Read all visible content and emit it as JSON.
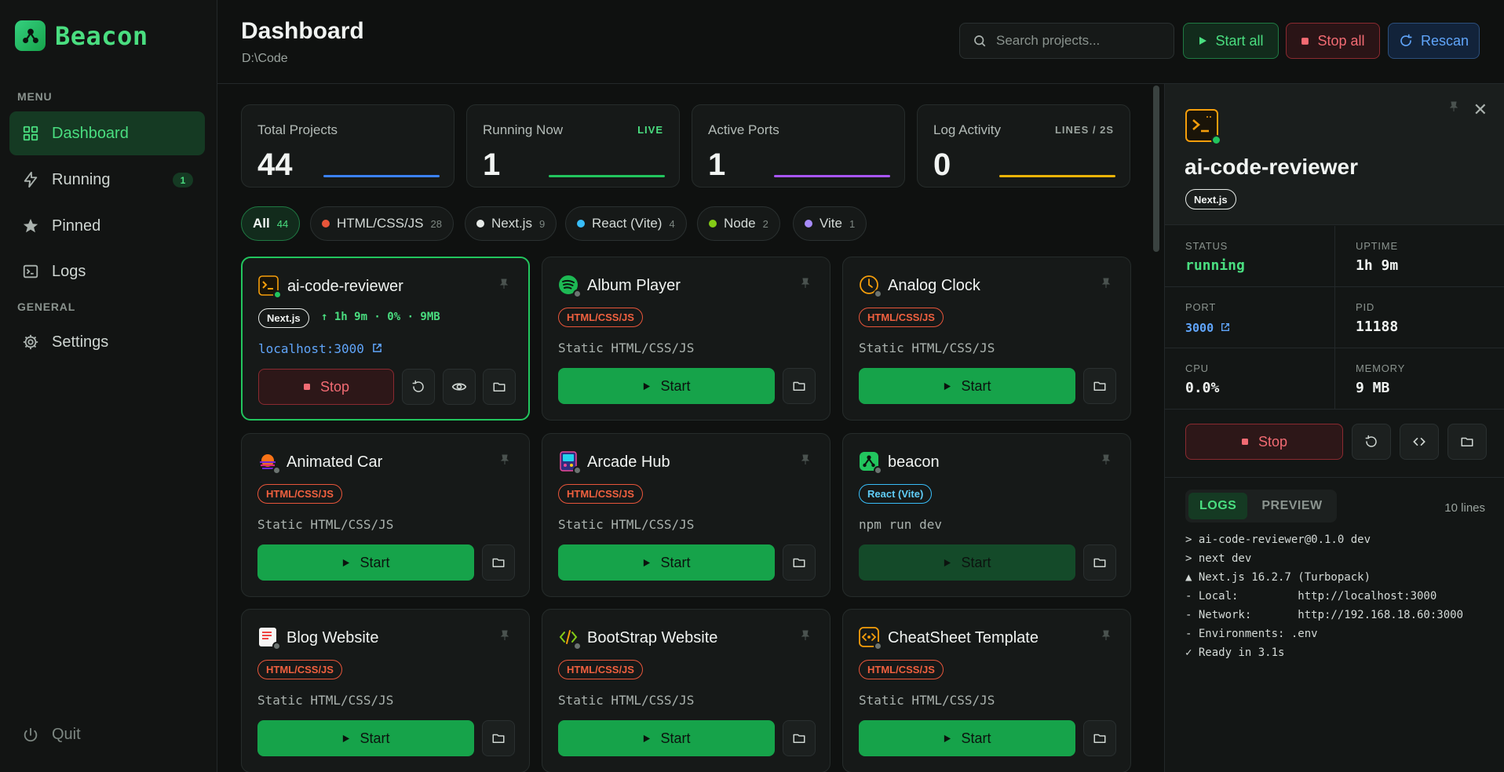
{
  "app": {
    "name": "Beacon"
  },
  "sidebar": {
    "menu_section": "MENU",
    "general_section": "GENERAL",
    "items": [
      {
        "label": "Dashboard"
      },
      {
        "label": "Running",
        "badge": "1"
      },
      {
        "label": "Pinned"
      },
      {
        "label": "Logs"
      },
      {
        "label": "Settings"
      }
    ],
    "quit_label": "Quit"
  },
  "header": {
    "title": "Dashboard",
    "path": "D:\\Code",
    "search_placeholder": "Search projects...",
    "start_all": "Start all",
    "stop_all": "Stop all",
    "rescan": "Rescan"
  },
  "stats": [
    {
      "label": "Total Projects",
      "value": "44",
      "tag": "",
      "color": "#3b82f6"
    },
    {
      "label": "Running Now",
      "value": "1",
      "tag": "LIVE",
      "color": "#22c55e"
    },
    {
      "label": "Active Ports",
      "value": "1",
      "tag": "",
      "color": "#a855f7"
    },
    {
      "label": "Log Activity",
      "value": "0",
      "tag": "LINES / 2S",
      "color": "#eab308"
    }
  ],
  "filters": [
    {
      "label": "All",
      "count": "44"
    },
    {
      "label": "HTML/CSS/JS",
      "count": "28",
      "color": "#e8553a"
    },
    {
      "label": "Next.js",
      "count": "9",
      "color": "#e7ebe8"
    },
    {
      "label": "React (Vite)",
      "count": "4",
      "color": "#38bdf8"
    },
    {
      "label": "Node",
      "count": "2",
      "color": "#84cc16"
    },
    {
      "label": "Vite",
      "count": "1",
      "color": "#a78bfa"
    }
  ],
  "cards": [
    {
      "name": "ai-code-reviewer",
      "badge": "Next.js",
      "uptime": "↑ 1h 9m · 0% · 9MB",
      "link": "localhost:3000",
      "action": "Stop",
      "icon": "terminal-icon"
    },
    {
      "name": "Album Player",
      "badge": "HTML/CSS/JS",
      "sub": "Static HTML/CSS/JS",
      "action": "Start",
      "icon": "spotify-icon"
    },
    {
      "name": "Analog Clock",
      "badge": "HTML/CSS/JS",
      "sub": "Static HTML/CSS/JS",
      "action": "Start",
      "icon": "clock-icon"
    },
    {
      "name": "Animated Car",
      "badge": "HTML/CSS/JS",
      "sub": "Static HTML/CSS/JS",
      "action": "Start",
      "icon": "sunset-icon"
    },
    {
      "name": "Arcade Hub",
      "badge": "HTML/CSS/JS",
      "sub": "Static HTML/CSS/JS",
      "action": "Start",
      "icon": "arcade-icon"
    },
    {
      "name": "beacon",
      "badge": "React (Vite)",
      "sub": "npm run dev",
      "action": "Start",
      "icon": "beacon-icon"
    },
    {
      "name": "Blog Website",
      "badge": "HTML/CSS/JS",
      "sub": "Static HTML/CSS/JS",
      "action": "Start",
      "icon": "document-icon"
    },
    {
      "name": "BootStrap Website",
      "badge": "HTML/CSS/JS",
      "sub": "Static HTML/CSS/JS",
      "action": "Start",
      "icon": "code-icon"
    },
    {
      "name": "CheatSheet Template",
      "badge": "HTML/CSS/JS",
      "sub": "Static HTML/CSS/JS",
      "action": "Start",
      "icon": "code-box-icon"
    }
  ],
  "panel": {
    "name": "ai-code-reviewer",
    "badge": "Next.js",
    "metrics": [
      {
        "label": "STATUS",
        "value": "running"
      },
      {
        "label": "UPTIME",
        "value": "1h 9m"
      },
      {
        "label": "PORT",
        "value": "3000"
      },
      {
        "label": "PID",
        "value": "11188"
      },
      {
        "label": "CPU",
        "value": "0.0%"
      },
      {
        "label": "MEMORY",
        "value": "9 MB"
      }
    ],
    "stop_label": "Stop",
    "tab_logs": "LOGS",
    "tab_preview": "PREVIEW",
    "lines_count": "10 lines",
    "logs": [
      "> ai-code-reviewer@0.1.0 dev",
      "> next dev",
      "▲ Next.js 16.2.7 (Turbopack)",
      "- Local:         http://localhost:3000",
      "- Network:       http://192.168.18.60:3000",
      "- Environments: .env",
      "✓ Ready in 3.1s"
    ]
  }
}
